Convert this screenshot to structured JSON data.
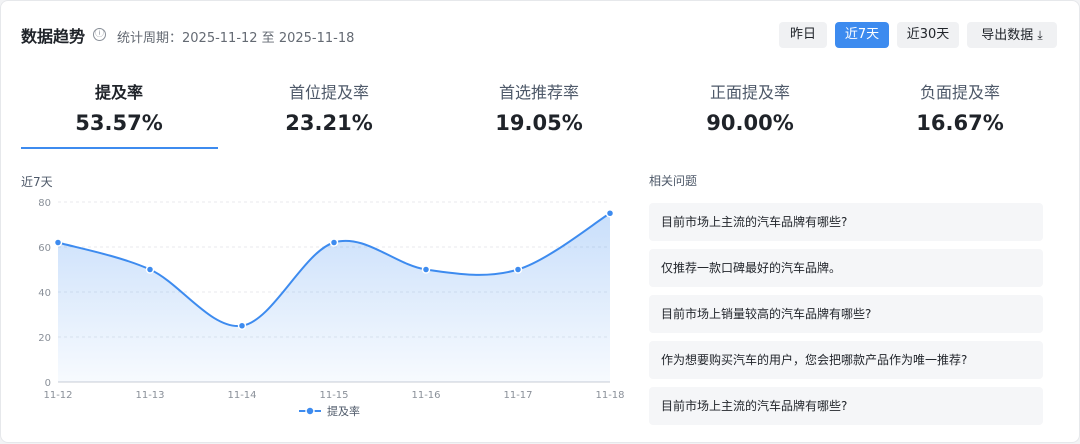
{
  "header": {
    "title": "数据趋势",
    "info_icon": "ⓘ",
    "period": "统计周期：2025-11-12 至 2025-11-18"
  },
  "range_buttons": [
    {
      "label": "昨日",
      "active": false
    },
    {
      "label": "近7天",
      "active": true
    },
    {
      "label": "近30天",
      "active": false
    }
  ],
  "export": {
    "label": "导出数据",
    "icon": "download-icon"
  },
  "metrics": [
    {
      "label": "提及率",
      "value": "53.57%",
      "active": true
    },
    {
      "label": "首位提及率",
      "value": "23.21%",
      "active": false
    },
    {
      "label": "首选推荐率",
      "value": "19.05%",
      "active": false
    },
    {
      "label": "正面提及率",
      "value": "90.00%",
      "active": false
    },
    {
      "label": "负面提及率",
      "value": "16.67%",
      "active": false
    }
  ],
  "chart_label": "近7天",
  "chart_data": {
    "type": "area",
    "x": [
      "11-12",
      "11-13",
      "11-14",
      "11-15",
      "11-16",
      "11-17",
      "11-18"
    ],
    "series": [
      {
        "name": "提及率",
        "values": [
          62,
          50,
          25,
          62,
          50,
          50,
          75
        ]
      }
    ],
    "yticks": [
      0,
      20,
      40,
      60,
      80
    ],
    "ylim": [
      0,
      80
    ],
    "grid": true,
    "legend": "bottom-center",
    "color": "#3d8bef"
  },
  "related": {
    "title": "相关问题",
    "questions": [
      "目前市场上主流的汽车品牌有哪些?",
      "仅推荐一款口碑最好的汽车品牌。",
      "目前市场上销量较高的汽车品牌有哪些?",
      "作为想要购买汽车的用户，您会把哪款产品作为唯一推荐?",
      "目前市场上主流的汽车品牌有哪些?"
    ]
  }
}
